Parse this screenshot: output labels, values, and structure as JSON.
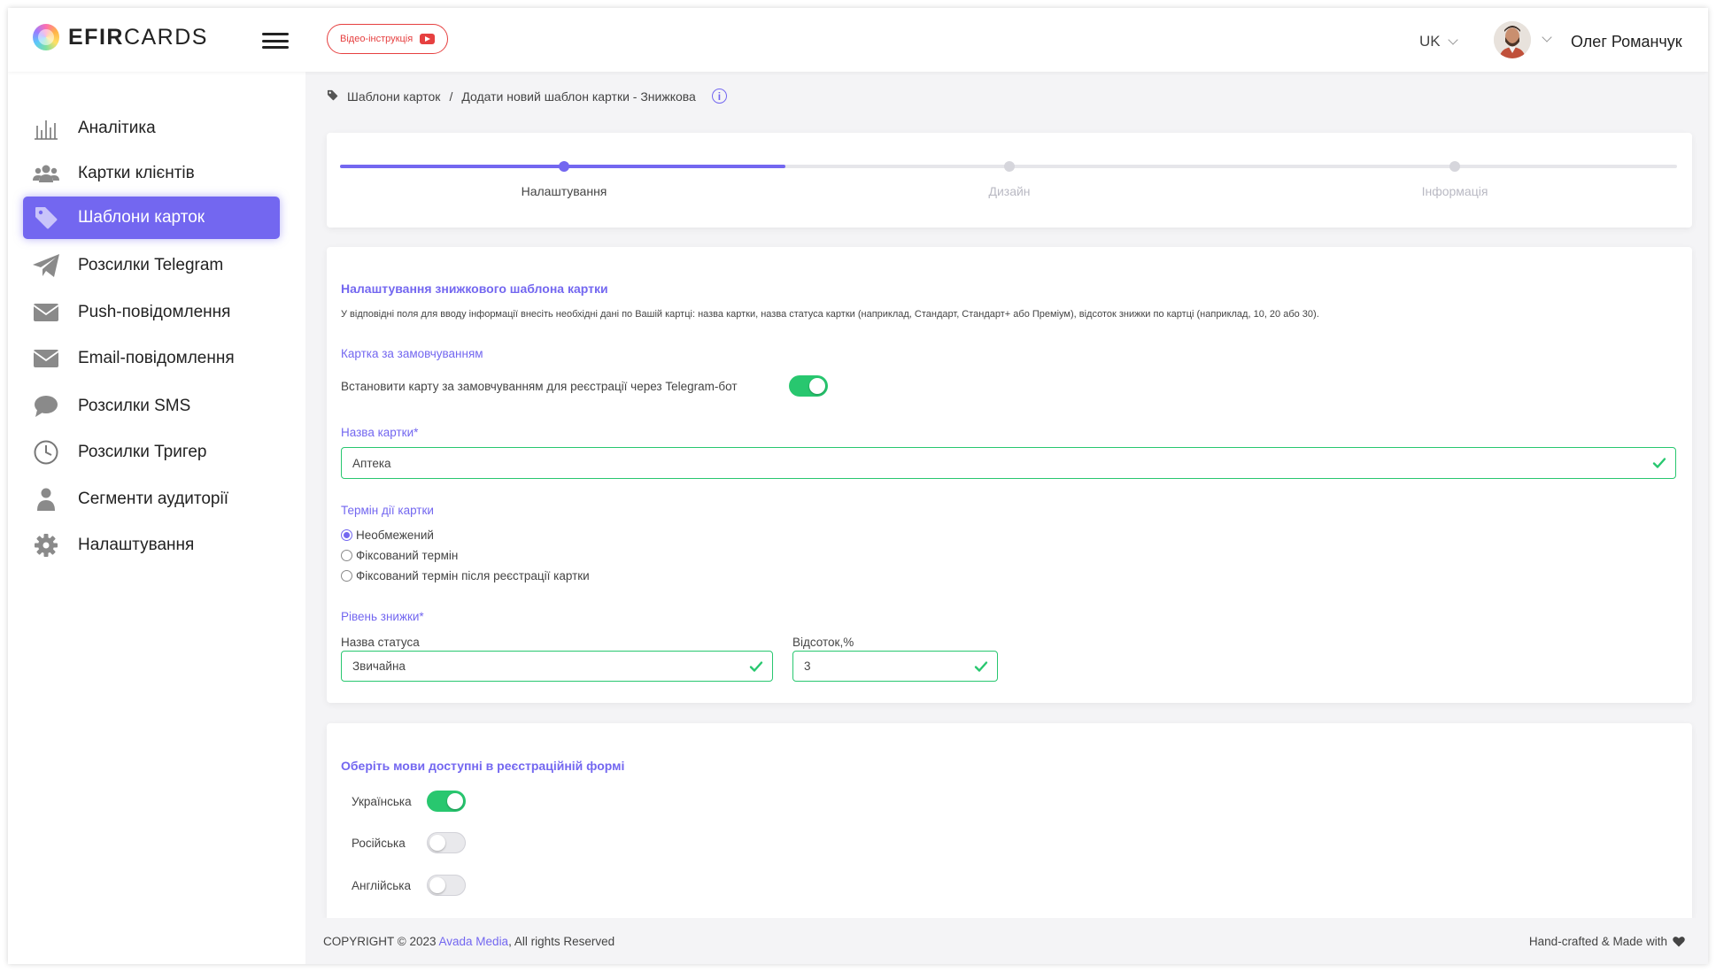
{
  "header": {
    "logo_bold": "EFIR",
    "logo_light": "CARDS",
    "video_button": "Відео-інструкція",
    "language": "UK",
    "user_name": "Олег Романчук"
  },
  "sidebar": {
    "items": [
      {
        "label": "Аналітика",
        "icon": "analytics-icon"
      },
      {
        "label": "Картки клієнтів",
        "icon": "users-icon"
      },
      {
        "label": "Шаблони карток",
        "icon": "tag-icon",
        "active": true
      },
      {
        "label": "Розсилки Telegram",
        "icon": "telegram-icon"
      },
      {
        "label": "Push-повідомлення",
        "icon": "mail-icon"
      },
      {
        "label": "Email-повідомлення",
        "icon": "mail-icon"
      },
      {
        "label": "Розсилки SMS",
        "icon": "chat-bubble-icon"
      },
      {
        "label": "Розсилки Тригер",
        "icon": "clock-icon"
      },
      {
        "label": "Сегменти аудиторії",
        "icon": "user-icon"
      },
      {
        "label": "Налаштування",
        "icon": "gear-icon"
      }
    ]
  },
  "breadcrumb": {
    "parent": "Шаблони карток",
    "separator": "/",
    "current": "Додати новий шаблон картки - Знижкова",
    "info": "i"
  },
  "stepper": {
    "steps": [
      {
        "label": "Налаштування",
        "active": true
      },
      {
        "label": "Дизайн",
        "active": false
      },
      {
        "label": "Інформація",
        "active": false
      }
    ],
    "progress": 0.333
  },
  "settings": {
    "title": "Налаштування знижкового шаблона картки",
    "description": "У відповідні поля для вводу інформації внесіть необхідні дані по Вашій картці: назва картки, назва статуса картки (наприклад, Стандарт, Стандарт+ або Преміум), відсоток знижки по картці (наприклад, 10, 20 або 30).",
    "default_card_label": "Картка за замовчуванням",
    "default_card_toggle_text": "Встановити карту за замовчуванням для реєстрації через Telegram-бот",
    "default_card_enabled": true,
    "card_name_label": "Назва картки*",
    "card_name_value": "Аптека",
    "term_label": "Термін дії картки",
    "term_options": [
      {
        "label": "Необмежений",
        "checked": true
      },
      {
        "label": "Фіксований термін",
        "checked": false
      },
      {
        "label": "Фіксований термін після реєстрації картки",
        "checked": false
      }
    ],
    "discount_level_label": "Рівень знижки*",
    "status_name_label": "Назва статуса",
    "status_name_value": "Звичайна",
    "percent_label": "Відсоток,%",
    "percent_value": "3"
  },
  "languages": {
    "title": "Оберіть мови доступні в реєстраційній формі",
    "items": [
      {
        "label": "Українська",
        "enabled": true
      },
      {
        "label": "Російська",
        "enabled": false
      },
      {
        "label": "Англійська",
        "enabled": false
      }
    ]
  },
  "footer": {
    "copyright_prefix": "COPYRIGHT © 2023",
    "company": "Avada Media",
    "copyright_suffix": ", All rights Reserved",
    "right_text": "Hand-crafted & Made with",
    "heart_icon": "heart-icon"
  },
  "colors": {
    "accent": "#7367f0",
    "success": "#28c76f",
    "danger": "#e64040"
  }
}
